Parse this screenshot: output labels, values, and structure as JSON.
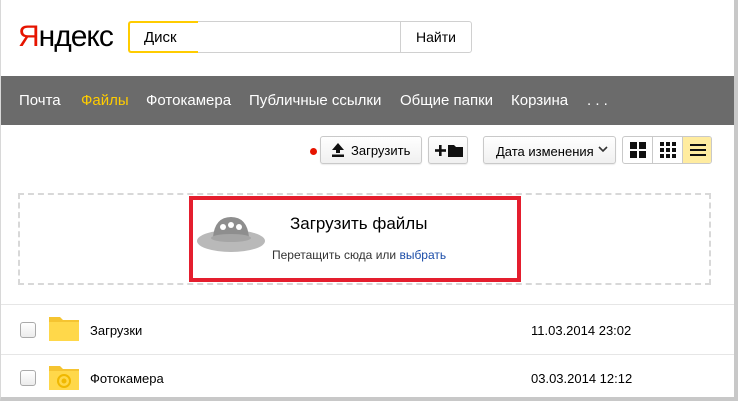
{
  "header": {
    "logo_first": "Я",
    "logo_rest": "ндекс",
    "search_tag": "Диск",
    "search_value": "",
    "search_button": "Найти"
  },
  "nav": {
    "items": [
      {
        "label": "Почта",
        "active": false
      },
      {
        "label": "Файлы",
        "active": true
      },
      {
        "label": "Фотокамера",
        "active": false
      },
      {
        "label": "Публичные ссылки",
        "active": false
      },
      {
        "label": "Общие папки",
        "active": false
      },
      {
        "label": "Корзина",
        "active": false
      },
      {
        "label": ". . .",
        "active": false
      }
    ]
  },
  "toolbar": {
    "upload_label": "Загрузить",
    "upload_icon": "upload-arrow-icon",
    "new_folder_icon": "plus-folder-icon",
    "sort_label": "Дата изменения",
    "view_modes": [
      "large-tiles",
      "small-tiles",
      "list"
    ],
    "active_view": "list"
  },
  "dropzone": {
    "title": "Загрузить файлы",
    "hint_prefix": "Перетащить сюда или ",
    "hint_link": "выбрать"
  },
  "files": [
    {
      "name": "Загрузки",
      "date": "11.03.2014 23:02",
      "icon": "folder-icon"
    },
    {
      "name": "Фотокамера",
      "date": "03.03.2014 12:12",
      "icon": "camera-folder-icon"
    }
  ],
  "colors": {
    "nav_bg": "#6b6b6b",
    "active_nav": "#ffcc00",
    "logo_red": "#e61400",
    "highlight_red": "#e41e2e",
    "link_blue": "#1a4ca8",
    "folder_yellow": "#ffd84a"
  }
}
